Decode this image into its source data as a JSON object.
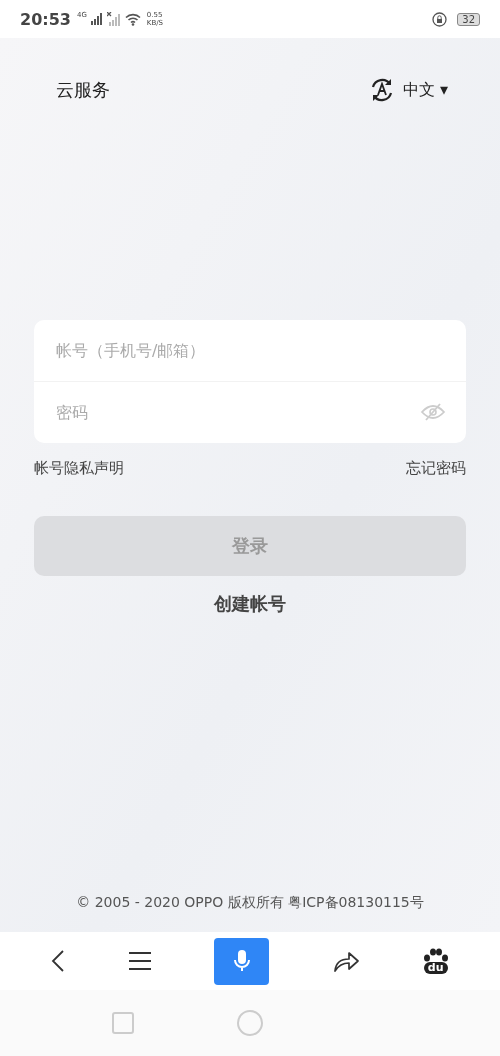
{
  "status_bar": {
    "time": "20:53",
    "network": "4G",
    "speed": "0.55",
    "speed_unit": "KB/S",
    "battery": "32"
  },
  "header": {
    "title": "云服务",
    "language": "中文",
    "dropdown_glyph": "▾"
  },
  "form": {
    "account": {
      "placeholder": "帐号（手机号/邮箱）"
    },
    "password": {
      "placeholder": "密码",
      "visible": false
    }
  },
  "links": {
    "privacy": "帐号隐私声明",
    "forgot": "忘记密码"
  },
  "login_button": {
    "label": "登录",
    "disabled": true
  },
  "create_account": "创建帐号",
  "footer": "© 2005 - 2020 OPPO 版权所有 粤ICP备08130115号",
  "browser_toolbar": {
    "logo_text": "du"
  }
}
